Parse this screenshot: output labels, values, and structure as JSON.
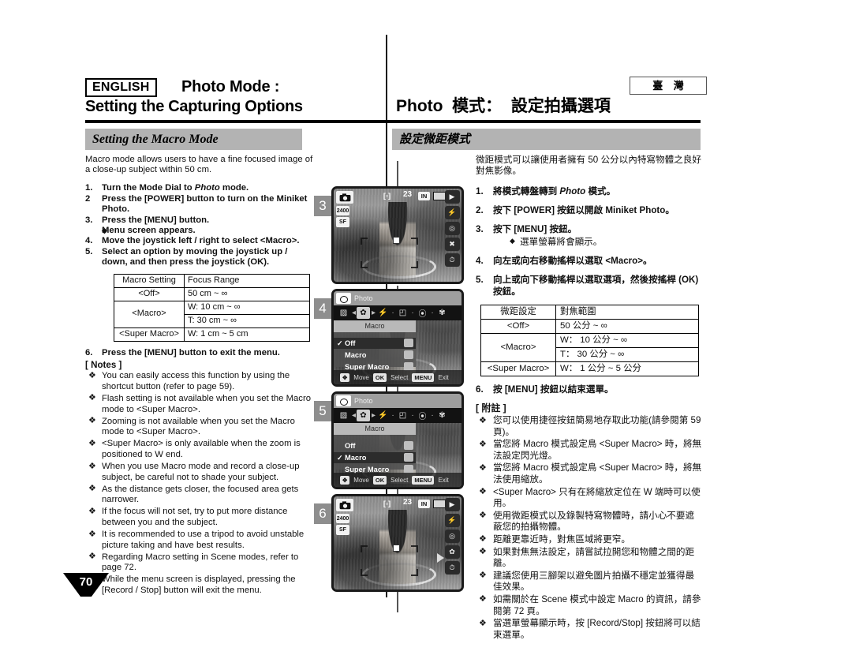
{
  "header": {
    "lang_badge": "ENGLISH",
    "title_en_line1": "Photo Mode :",
    "title_en_line2": "Setting the Capturing Options",
    "title_zh": "Photo  模式：  設定拍攝選項",
    "region_badge": "臺 灣"
  },
  "section": {
    "title_en": "Setting the Macro Mode",
    "title_zh": "設定微距模式"
  },
  "english": {
    "intro": "Macro mode allows users to have a fine focused image of a close-up subject within 50 cm.",
    "steps": [
      {
        "num": "1.",
        "text_before": "Turn the Mode Dial to ",
        "italic": "Photo",
        "text_after": " mode."
      },
      {
        "num": "2",
        "text_before": "Press the [POWER] button to turn on the Miniket Photo.",
        "italic": "",
        "text_after": ""
      },
      {
        "num": "3.",
        "text_before": "Press the [MENU] button.",
        "italic": "",
        "text_after": ""
      },
      {
        "num": "4.",
        "text_before": "Move the joystick left / right to select <Macro>.",
        "italic": "",
        "text_after": ""
      },
      {
        "num": "5.",
        "text_before": "Select an option by moving the joystick up / down, and then press the joystick (OK).",
        "italic": "",
        "text_after": ""
      },
      {
        "num": "6.",
        "text_before": "Press the [MENU] button to exit the menu.",
        "italic": "",
        "text_after": ""
      }
    ],
    "step3_sub": "Menu screen appears.",
    "table": {
      "headers": [
        "Macro Setting",
        "Focus Range"
      ],
      "rows": [
        {
          "setting": "<Off>",
          "ranges": [
            "50 cm ~ ∞"
          ]
        },
        {
          "setting": "<Macro>",
          "ranges": [
            "W: 10 cm ~ ∞",
            "T: 30 cm ~ ∞"
          ]
        },
        {
          "setting": "<Super Macro>",
          "ranges": [
            "W: 1 cm ~ 5 cm"
          ]
        }
      ]
    },
    "notes_title": "[ Notes ]",
    "notes": [
      "You can easily access this function by using the shortcut button (refer to page 59).",
      "Flash setting is not available when you set the Macro mode to <Super Macro>.",
      "Zooming is not available when you set the Macro mode to <Super Macro>.",
      "<Super Macro> is only available when the zoom is positioned to W end.",
      "When you use Macro mode and record a close-up subject, be careful not to shade your subject.",
      "As the distance gets closer, the focused area gets narrower.",
      "If the focus will not set, try to put more distance between you and the subject.",
      "It is recommended to use a tripod to avoid unstable picture taking and have best results.",
      "Regarding Macro setting in Scene modes, refer to page 72.",
      "While the menu screen is displayed, pressing the [Record / Stop] button will exit the menu."
    ]
  },
  "chinese": {
    "intro": "微距模式可以讓使用者擁有 50 公分以內特寫物體之良好對焦影像。",
    "steps": [
      {
        "num": "1.",
        "text_before": "將模式轉盤轉到 ",
        "italic": "Photo",
        "text_after": " 模式。"
      },
      {
        "num": "2.",
        "text_before": "按下 [POWER] 按鈕以開啟 Miniket Photo。",
        "italic": "",
        "text_after": ""
      },
      {
        "num": "3.",
        "text_before": "按下 [MENU] 按鈕。",
        "italic": "",
        "text_after": ""
      },
      {
        "num": "4.",
        "text_before": "向左或向右移動搖桿以選取 <Macro>。",
        "italic": "",
        "text_after": ""
      },
      {
        "num": "5.",
        "text_before": "向上或向下移動搖桿以選取選項，然後按搖桿 (OK) 按鈕。",
        "italic": "",
        "text_after": ""
      },
      {
        "num": "6.",
        "text_before": "按 [MENU] 按鈕以結束選單。",
        "italic": "",
        "text_after": ""
      }
    ],
    "step3_sub": "選單螢幕將會顯示。",
    "table": {
      "headers": [
        "微距設定",
        "對焦範圍"
      ],
      "rows": [
        {
          "setting": "<Off>",
          "ranges": [
            "50 公分 ~ ∞"
          ]
        },
        {
          "setting": "<Macro>",
          "ranges": [
            "W： 10 公分 ~ ∞",
            "T： 30 公分 ~ ∞"
          ]
        },
        {
          "setting": "<Super Macro>",
          "ranges": [
            "W： 1 公分 ~ 5 公分"
          ]
        }
      ]
    },
    "notes_title": "[ 附註 ]",
    "notes": [
      "您可以使用捷徑按鈕簡易地存取此功能(請參閱第 59 頁)。",
      "當您將 Macro 模式設定鳥 <Super Macro> 時，將無法設定閃光燈。",
      "當您將 Macro 模式設定鳥 <Super Macro> 時，將無法使用縮放。",
      "<Super Macro> 只有在將縮放定位在 W 端時可以使用。",
      "使用微距模式以及錄製特寫物體時，請小心不要遮蔽您的拍攝物體。",
      "距離更靠近時，對焦區域將更窄。",
      "如果對焦無法設定，請嘗試拉開您和物體之間的距離。",
      "建議您使用三腳架以避免圖片拍攝不穩定並獲得最佳效果。",
      "如需關於在 Scene 模式中設定 Macro 的資訊，請參閱第 72 頁。",
      "當選單螢幕顯示時，按 [Record/Stop] 按鈕將可以結束選單。"
    ]
  },
  "figures": [
    {
      "step": "3",
      "kind": "live",
      "osd": {
        "counter": "23",
        "memory": "IN",
        "mode_icon": "camera-icon",
        "quality": "2400",
        "size_icon": "sf-icon"
      },
      "rail": [
        "playback-icon",
        "flash-icon",
        "exposure-icon",
        "macro-off-icon",
        "timer-icon"
      ]
    },
    {
      "step": "4",
      "kind": "menu",
      "menu": {
        "title": "Photo",
        "group": "Macro",
        "items": [
          {
            "label": "Off",
            "selected": true,
            "checked": true
          },
          {
            "label": "Macro",
            "selected": false,
            "checked": false
          },
          {
            "label": "Super Macro",
            "selected": false,
            "checked": false
          }
        ],
        "hints": [
          {
            "key": "",
            "label": "Move"
          },
          {
            "key": "OK",
            "label": "Select"
          },
          {
            "key": "MENU",
            "label": "Exit"
          }
        ]
      }
    },
    {
      "step": "5",
      "kind": "menu",
      "menu": {
        "title": "Photo",
        "group": "Macro",
        "items": [
          {
            "label": "Off",
            "selected": false,
            "checked": false
          },
          {
            "label": "Macro",
            "selected": true,
            "checked": true
          },
          {
            "label": "Super Macro",
            "selected": false,
            "checked": false
          }
        ],
        "hints": [
          {
            "key": "",
            "label": "Move"
          },
          {
            "key": "OK",
            "label": "Select"
          },
          {
            "key": "MENU",
            "label": "Exit"
          }
        ]
      }
    },
    {
      "step": "6",
      "kind": "live",
      "osd": {
        "counter": "23",
        "memory": "IN",
        "mode_icon": "camera-icon",
        "quality": "2400",
        "size_icon": "sf-icon"
      },
      "rail": [
        "playback-icon",
        "flash-icon",
        "exposure-icon",
        "macro-on-icon",
        "timer-icon"
      ]
    }
  ],
  "footer": {
    "page_number": "70"
  }
}
